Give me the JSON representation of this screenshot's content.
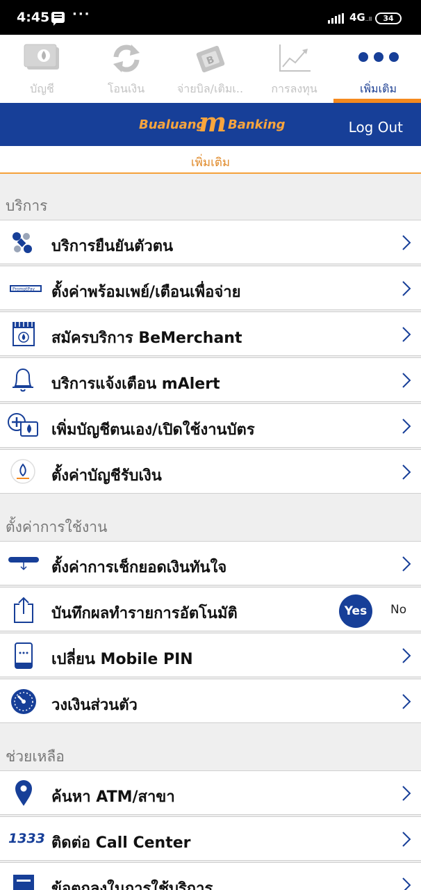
{
  "status_bar": {
    "time": "4:45",
    "network": "4G",
    "network_sub": "..ll",
    "battery": "34"
  },
  "tabs": [
    {
      "label": "บัญชี",
      "icon": "account-icon",
      "active": false
    },
    {
      "label": "โอนเงิน",
      "icon": "transfer-icon",
      "active": false
    },
    {
      "label": "จ่ายบิล/เติมเ..",
      "icon": "bill-payment-icon",
      "active": false
    },
    {
      "label": "การลงทุน",
      "icon": "investment-chart-icon",
      "active": false
    },
    {
      "label": "เพิ่มเติม",
      "icon": "more-dots-icon",
      "active": true
    }
  ],
  "header": {
    "logo_part1": "Bualuang",
    "logo_m": "m",
    "logo_part2": "Banking",
    "logout": "Log Out"
  },
  "page_title": "เพิ่มเติม",
  "sections": [
    {
      "title": "บริการ",
      "items": [
        {
          "label": "บริการยืนยันตัวตน",
          "icon": "identity-verification-icon"
        },
        {
          "label": "ตั้งค่าพร้อมเพย์/เตือนเพื่อจ่าย",
          "icon": "promptpay-icon",
          "icon_text": "PromptPay"
        },
        {
          "label": "สมัครบริการ BeMerchant",
          "icon": "merchant-store-icon"
        },
        {
          "label": "บริการแจ้งเตือน mAlert",
          "icon": "bell-icon"
        },
        {
          "label": "เพิ่มบัญชีตนเอง/เปิดใช้งานบัตร",
          "icon": "add-account-icon"
        },
        {
          "label": "ตั้งค่าบัญชีรับเงิน",
          "icon": "receiving-account-icon"
        }
      ]
    },
    {
      "title": "ตั้งค่าการใช้งาน",
      "items": [
        {
          "label": "ตั้งค่าการเช็กยอดเงินทันใจ",
          "icon": "quick-balance-icon"
        },
        {
          "label": "บันทึกผลทำรายการอัตโนมัติ",
          "icon": "share-export-icon",
          "toggle": {
            "yes": "Yes",
            "no": "No",
            "selected": "Yes"
          }
        },
        {
          "label": "เปลี่ยน Mobile PIN",
          "icon": "mobile-pin-icon"
        },
        {
          "label": "วงเงินส่วนตัว",
          "icon": "speedometer-icon"
        }
      ]
    },
    {
      "title": "ช่วยเหลือ",
      "items": [
        {
          "label": "ค้นหา ATM/สาขา",
          "icon": "location-pin-icon"
        },
        {
          "label": "ติดต่อ Call Center",
          "icon": "call-center-1333-icon",
          "icon_text": "1333"
        },
        {
          "label": "ข้อตกลงในการใช้บริการ",
          "icon": "terms-document-icon"
        }
      ]
    }
  ],
  "colors": {
    "brand_blue": "#173f98",
    "accent_orange": "#f58a1f",
    "inactive_tab": "#c3c3c3"
  }
}
